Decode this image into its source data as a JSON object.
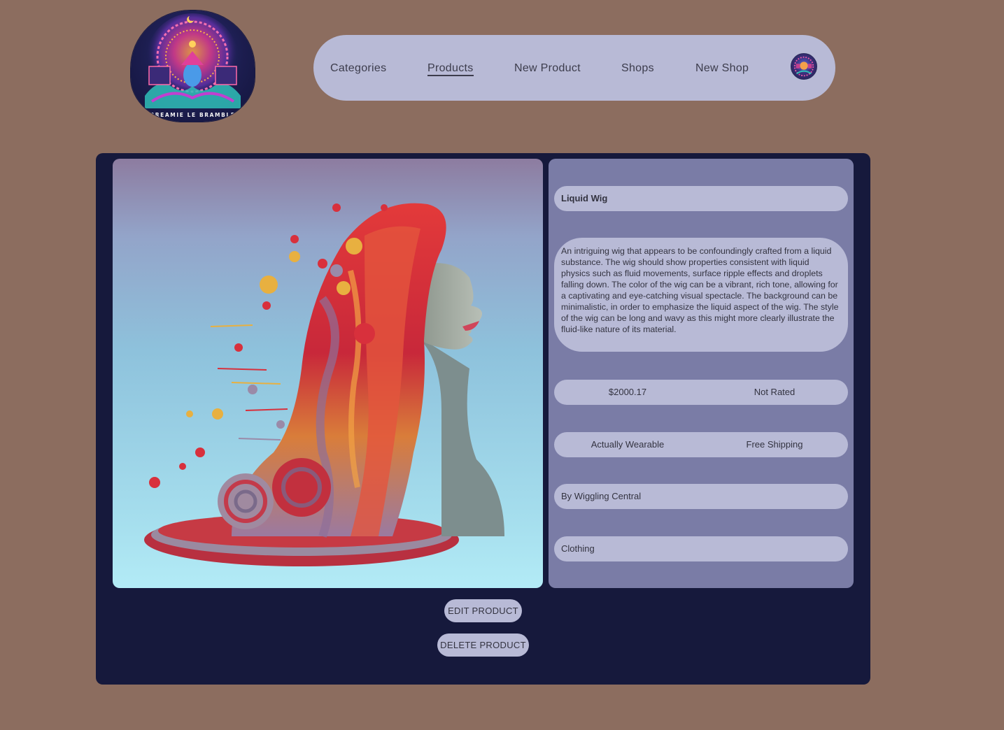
{
  "logo": {
    "text": "BREAMIE LE BRAMBLE",
    "icon": "mandala-logo-icon"
  },
  "nav": {
    "items": [
      {
        "label": "Categories",
        "active": false
      },
      {
        "label": "Products",
        "active": true
      },
      {
        "label": "New Product",
        "active": false
      },
      {
        "label": "Shops",
        "active": false
      },
      {
        "label": "New Shop",
        "active": false
      }
    ],
    "avatar_icon": "user-avatar-icon"
  },
  "product": {
    "image_icon": "liquid-wig-mannequin-image",
    "name": "Liquid Wig",
    "description": "An intriguing wig that appears to be confoundingly crafted from a liquid substance. The wig should show properties consistent with liquid physics such as fluid movements, surface ripple effects and droplets falling down. The color of the wig can be a vibrant, rich tone, allowing for a captivating and eye-catching visual spectacle. The background can be minimalistic, in order to emphasize the liquid aspect of the wig. The style of the wig can be long and wavy as this might more clearly illustrate the fluid-like nature of its material.",
    "price": "$2000.17",
    "rating": "Not Rated",
    "wearable": "Actually Wearable",
    "shipping": "Free Shipping",
    "shop": "By Wiggling Central",
    "category": "Clothing"
  },
  "actions": {
    "edit_label": "EDIT PRODUCT",
    "delete_label": "DELETE PRODUCT"
  },
  "colors": {
    "page_bg": "#8c6d5f",
    "nav_bg": "#b8bad6",
    "card_bg": "#16193c",
    "details_bg": "#7a7ca6",
    "field_bg": "#b8bad6"
  }
}
